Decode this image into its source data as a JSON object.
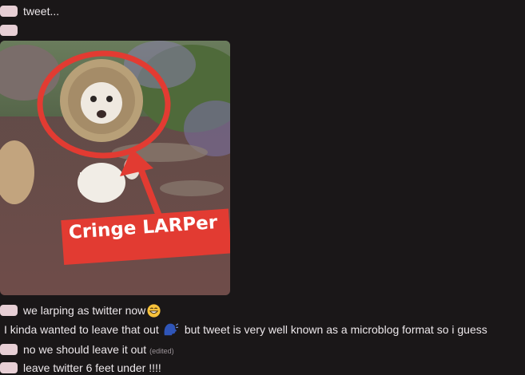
{
  "messages": [
    {
      "id": "m1",
      "text": "tweet..."
    },
    {
      "id": "m2",
      "text": ""
    },
    {
      "id": "m3",
      "text": "we larping as twitter now",
      "emoji": "grinning-emoji"
    },
    {
      "id": "m4",
      "text_before": "I kinda wanted to leave that out",
      "emoji": "speaking-head-emoji",
      "text_after": "but tweet is very well known as a microblog format so i guess"
    },
    {
      "id": "m5",
      "text": "no we should leave it out",
      "edited": "(edited)"
    },
    {
      "id": "m6",
      "text": "leave twitter 6 feet under !!!!"
    }
  ],
  "media": {
    "caption": "Cringe LARPer",
    "subject": "cat wearing lion mane costume",
    "colors": {
      "annotation": "#e23b32",
      "ground": "#6e4a45",
      "foliage": "#4f6a3a"
    }
  },
  "theme": {
    "background": "#1a1718",
    "text": "#ece7ea",
    "pill": "#e7cfd5",
    "muted": "#9b9398"
  }
}
